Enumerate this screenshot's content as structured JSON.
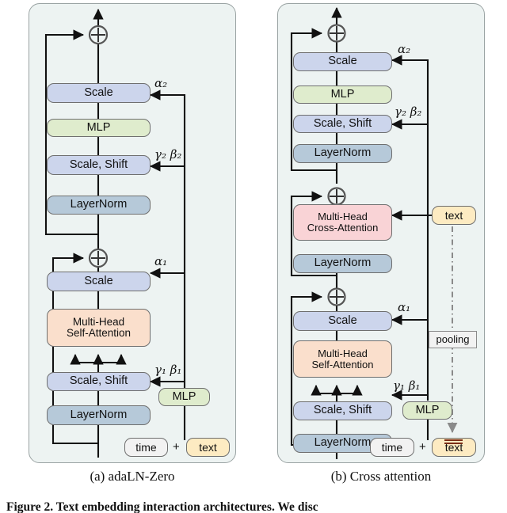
{
  "figure": {
    "caption_line": "Figure 2. Text embedding interaction architectures. We disc",
    "subcaptions": [
      {
        "id": "a",
        "label": "(a) adaLN-Zero"
      },
      {
        "id": "b",
        "label": "(b) Cross attention"
      }
    ]
  },
  "colors": {
    "panel_bg": "#edf3f2",
    "panel_border": "#9aa3a3",
    "scale": "#ccd5ec",
    "mlp": "#dfeccd",
    "layernorm": "#b6c9d9",
    "self_attention": "#fadfcc",
    "cross_attention": "#f9d3d6",
    "time": "#f2f2f2",
    "text": "#fdebc2",
    "pooling": "#f2f2f2",
    "arrow": "#111111",
    "pooling_line": "#8a8a8a",
    "text_marker": "#7a2d16"
  },
  "panel_a": {
    "title": "(a) adaLN-Zero",
    "blocks": [
      {
        "name": "scale-2",
        "label": "Scale",
        "style": "scale"
      },
      {
        "name": "mlp-2",
        "label": "MLP",
        "style": "mlp"
      },
      {
        "name": "scale-shift-2",
        "label": "Scale, Shift",
        "style": "scale"
      },
      {
        "name": "layernorm-2",
        "label": "LayerNorm",
        "style": "layernorm"
      },
      {
        "name": "scale-1",
        "label": "Scale",
        "style": "scale"
      },
      {
        "name": "multi-head-self-attention",
        "label_line1": "Multi-Head",
        "label_line2": "Self-Attention",
        "style": "self_attention"
      },
      {
        "name": "scale-shift-1",
        "label": "Scale, Shift",
        "style": "scale"
      },
      {
        "name": "layernorm-1",
        "label": "LayerNorm",
        "style": "layernorm"
      },
      {
        "name": "conditioning-mlp",
        "label": "MLP",
        "style": "mlp"
      },
      {
        "name": "time-token",
        "label": "time",
        "style": "time"
      },
      {
        "name": "text-token",
        "label": "text",
        "style": "text"
      }
    ],
    "labels": {
      "alpha2": "α₂",
      "gamma2_beta2": "γ₂ β₂",
      "alpha1": "α₁",
      "gamma1_beta1": "γ₁ β₁",
      "plus": "+"
    },
    "operators": [
      {
        "name": "residual-add-top",
        "symbol": "⊕"
      },
      {
        "name": "residual-add-mid",
        "symbol": "⊕"
      }
    ]
  },
  "panel_b": {
    "title": "(b) Cross attention",
    "blocks": [
      {
        "name": "scale-2",
        "label": "Scale",
        "style": "scale"
      },
      {
        "name": "mlp-2",
        "label": "MLP",
        "style": "mlp"
      },
      {
        "name": "scale-shift-2",
        "label": "Scale, Shift",
        "style": "scale"
      },
      {
        "name": "layernorm-3",
        "label": "LayerNorm",
        "style": "layernorm"
      },
      {
        "name": "multi-head-cross-attention",
        "label_line1": "Multi-Head",
        "label_line2": "Cross-Attention",
        "style": "cross_attention"
      },
      {
        "name": "layernorm-2",
        "label": "LayerNorm",
        "style": "layernorm"
      },
      {
        "name": "scale-1",
        "label": "Scale",
        "style": "scale"
      },
      {
        "name": "multi-head-self-attention",
        "label_line1": "Multi-Head",
        "label_line2": "Self-Attention",
        "style": "self_attention"
      },
      {
        "name": "scale-shift-1",
        "label": "Scale, Shift",
        "style": "scale"
      },
      {
        "name": "layernorm-1",
        "label": "LayerNorm",
        "style": "layernorm"
      },
      {
        "name": "conditioning-mlp",
        "label": "MLP",
        "style": "mlp"
      },
      {
        "name": "time-token",
        "label": "time",
        "style": "time"
      },
      {
        "name": "text-token",
        "label": "text",
        "style": "text"
      },
      {
        "name": "text-context",
        "label": "text",
        "style": "text"
      },
      {
        "name": "pooling-box",
        "label": "pooling",
        "style": "pooling"
      }
    ],
    "labels": {
      "alpha2": "α₂",
      "gamma2_beta2": "γ₂ β₂",
      "alpha1": "α₁",
      "gamma1_beta1": "γ₁ β₁",
      "plus": "+"
    },
    "operators": [
      {
        "name": "residual-add-top",
        "symbol": "⊕"
      },
      {
        "name": "residual-add-cross",
        "symbol": "⊕"
      },
      {
        "name": "residual-add-self",
        "symbol": "⊕"
      }
    ]
  }
}
